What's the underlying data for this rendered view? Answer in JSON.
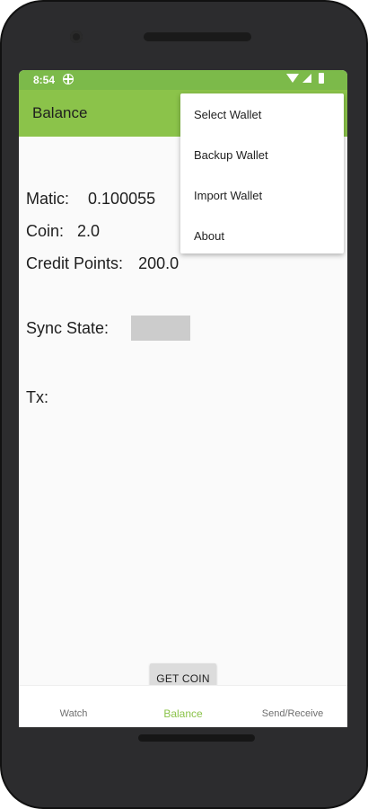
{
  "status_bar": {
    "time": "8:54"
  },
  "app_bar": {
    "title": "Balance"
  },
  "balance": {
    "matic_label": "Matic:",
    "matic_value": "0.100055",
    "coin_label": "Coin:",
    "coin_value": "2.0",
    "credit_label": "Credit Points:",
    "credit_value": "200.0",
    "sync_label": "Sync State:",
    "tx_label": "Tx:"
  },
  "actions": {
    "get_coin": "GET COIN"
  },
  "bottom_nav": {
    "items": [
      {
        "label": "Watch",
        "active": false
      },
      {
        "label": "Balance",
        "active": true
      },
      {
        "label": "Send/Receive",
        "active": false
      }
    ]
  },
  "overflow_menu": {
    "items": [
      {
        "label": "Select Wallet"
      },
      {
        "label": "Backup Wallet"
      },
      {
        "label": "Import Wallet"
      },
      {
        "label": "About"
      }
    ]
  },
  "colors": {
    "status_bar": "#7cba4a",
    "app_bar": "#8bc34a",
    "active_nav": "#8bc34a",
    "sync_box": "#cccccc"
  }
}
